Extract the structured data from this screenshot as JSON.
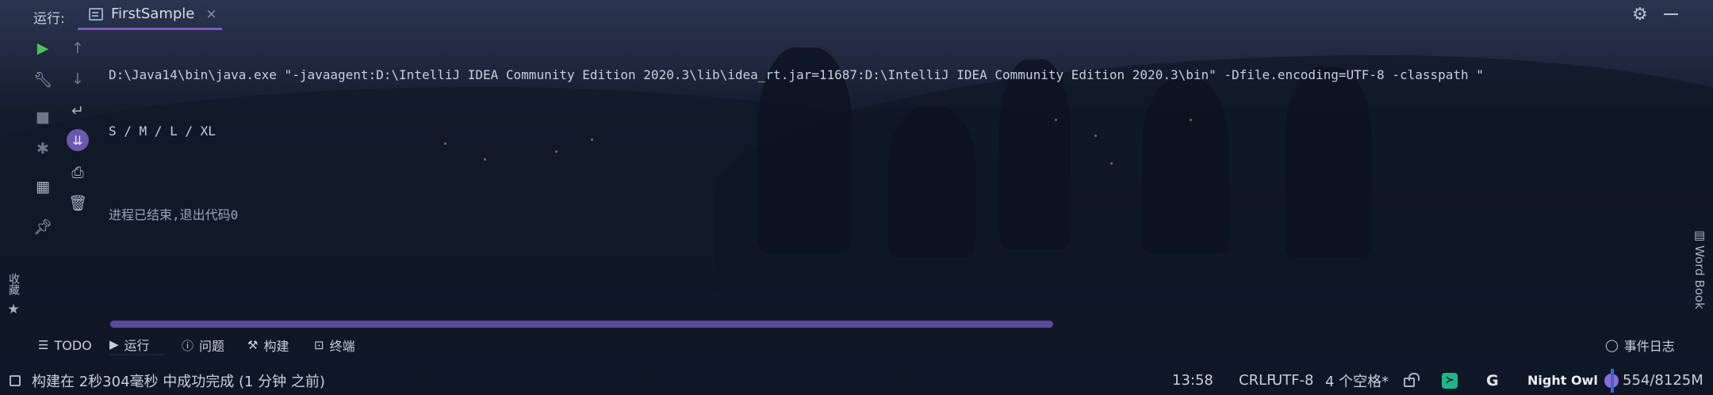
{
  "header": {
    "run_label": "运行:",
    "tab_label": "FirstSample",
    "tab_close": "×"
  },
  "left_toolbar": {
    "icons": [
      "play-icon",
      "wrench-icon",
      "stop-icon",
      "debug-icon",
      "layout-icon",
      "pin-icon"
    ],
    "icons2": [
      "arrow-up-icon",
      "arrow-down-icon",
      "soft-wrap-icon",
      "scroll-to-end-icon",
      "print-icon",
      "trash-icon"
    ]
  },
  "console": {
    "lines": [
      "D:\\Java14\\bin\\java.exe \"-javaagent:D:\\IntelliJ IDEA Community Edition 2020.3\\lib\\idea_rt.jar=11687:D:\\IntelliJ IDEA Community Edition 2020.3\\bin\" -Dfile.encoding=UTF-8 -classpath \"",
      "S / M / L / XL"
    ],
    "exit_message": "进程已结束,退出代码0"
  },
  "sidebar_right": {
    "word_book": "Word Book"
  },
  "sidebar_left": {
    "favorites": "收藏"
  },
  "bottom_tools": {
    "todo": "TODO",
    "run": "运行",
    "problems": "问题",
    "build": "构建",
    "terminal": "终端",
    "event_log": "事件日志"
  },
  "status_bar": {
    "message": "构建在 2秒304毫秒 中成功完成 (1 分钟 之前)",
    "position": "13:58",
    "line_separator": "CRLF",
    "encoding": "UTF-8",
    "indent": "4 个空格*",
    "theme": "Night Owl",
    "memory": "554/8125M"
  },
  "colors": {
    "accent": "#7c5cbf",
    "run_green": "#4fbf5b",
    "theme_dot": "#8d6bdc"
  }
}
